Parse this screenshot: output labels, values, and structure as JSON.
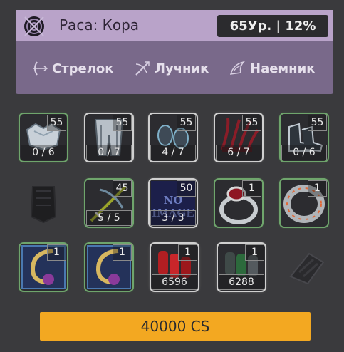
{
  "header": {
    "race_label": "Раса: Кора",
    "level_text": "65Ур. | 12%"
  },
  "classes": [
    {
      "label": "Стрелок",
      "icon": "bow-arrow-icon"
    },
    {
      "label": "Лучник",
      "icon": "crossbow-icon"
    },
    {
      "label": "Наемник",
      "icon": "wings-icon"
    }
  ],
  "items": [
    {
      "name": "chest-armor",
      "level": "55",
      "count": "0 / 6",
      "frame": "green"
    },
    {
      "name": "leg-armor",
      "level": "55",
      "count": "0 / 7",
      "frame": "white"
    },
    {
      "name": "gloves",
      "level": "55",
      "count": "4 / 7",
      "frame": "white"
    },
    {
      "name": "red-claws",
      "level": "55",
      "count": "6 / 7",
      "frame": "white"
    },
    {
      "name": "boots",
      "level": "55",
      "count": "0 / 6",
      "frame": "green"
    },
    {
      "name": "empty-shield",
      "level": "",
      "count": "",
      "frame": "empty"
    },
    {
      "name": "crossbow",
      "level": "45",
      "count": "5 / 5",
      "frame": "green"
    },
    {
      "name": "no-image-item",
      "level": "50",
      "count": "3 / 3",
      "frame": "white",
      "placeholder": "NO IMAGE"
    },
    {
      "name": "ruby-ring",
      "level": "1",
      "count": "",
      "frame": "green"
    },
    {
      "name": "silver-ring",
      "level": "1",
      "count": "",
      "frame": "green"
    },
    {
      "name": "gold-hook-a",
      "level": "1",
      "count": "",
      "frame": "green"
    },
    {
      "name": "gold-hook-b",
      "level": "1",
      "count": "",
      "frame": "green"
    },
    {
      "name": "red-capsules",
      "level": "1",
      "count": "6596",
      "frame": "white"
    },
    {
      "name": "green-capsules",
      "level": "1",
      "count": "6288",
      "frame": "white"
    },
    {
      "name": "empty-glove",
      "level": "",
      "count": "",
      "frame": "empty"
    }
  ],
  "price_button": {
    "label": "40000 CS"
  },
  "colors": {
    "accent": "#f3a821",
    "header": "#b9a3c9",
    "panel": "#79698a",
    "frame_green": "#6fa56c"
  }
}
